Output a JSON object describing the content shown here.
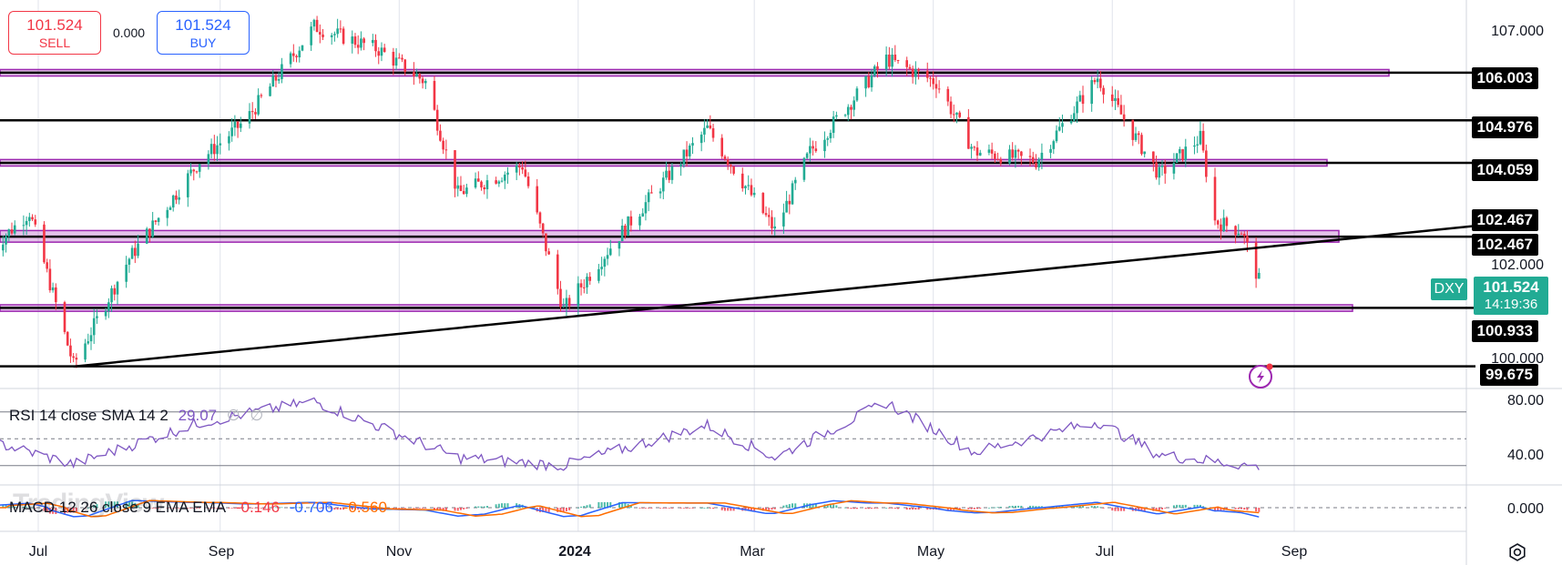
{
  "trade": {
    "sell_price": "101.524",
    "sell_label": "SELL",
    "spread": "0.000",
    "buy_price": "101.524",
    "buy_label": "BUY"
  },
  "symbol": "DXY",
  "current_price": "101.524",
  "countdown": "14:19:36",
  "watermark": "TradingView",
  "rsi": {
    "label": "RSI 14 close SMA 14 2",
    "value": "29.07",
    "extra1": "∅",
    "extra2": "∅"
  },
  "macd": {
    "label": "MACD 12 26 close 9 EMA EMA",
    "hist": "-0.146",
    "macd": "-0.706",
    "signal": "-0.560"
  },
  "price_axis": {
    "ticks": [
      "107.000",
      "102.000",
      "100.000"
    ],
    "level_tags": [
      "106.003",
      "104.976",
      "104.059",
      "102.467",
      "102.467",
      "100.933",
      "99.675"
    ]
  },
  "rsi_axis": {
    "ticks": [
      "80.00",
      "40.00"
    ]
  },
  "macd_axis": {
    "ticks": [
      "0.000"
    ]
  },
  "time_axis": {
    "labels": [
      {
        "text": "Jul",
        "bold": false
      },
      {
        "text": "Sep",
        "bold": false
      },
      {
        "text": "Nov",
        "bold": false
      },
      {
        "text": "2024",
        "bold": true
      },
      {
        "text": "Mar",
        "bold": false
      },
      {
        "text": "May",
        "bold": false
      },
      {
        "text": "Jul",
        "bold": false
      },
      {
        "text": "Sep",
        "bold": false
      }
    ]
  },
  "colors": {
    "up": "#22ab94",
    "down": "#f23645",
    "zone": "#9c27b0",
    "rsi": "#7e57c2",
    "macd": "#2962ff",
    "signal": "#ff6d00"
  },
  "chart_data": {
    "type": "candlestick",
    "symbol": "DXY",
    "ylim": [
      99.3,
      107.4
    ],
    "period": "Jun 2023 – Aug 2024",
    "horizontal_levels": [
      106.003,
      104.976,
      104.059,
      102.467,
      100.933,
      99.675
    ],
    "zones": [
      {
        "low": 105.93,
        "high": 106.07
      },
      {
        "low": 103.99,
        "high": 104.13
      },
      {
        "low": 102.35,
        "high": 102.6
      },
      {
        "low": 100.86,
        "high": 101.0
      }
    ],
    "trendline": {
      "from": "2023-07-13",
      "from_value": 99.67,
      "to_value": 102.7
    },
    "series_close_anchors": [
      {
        "x": "2023-06-15",
        "y": 102.2
      },
      {
        "x": "2023-06-28",
        "y": 103.0
      },
      {
        "x": "2023-07-13",
        "y": 99.7
      },
      {
        "x": "2023-08-01",
        "y": 102.0
      },
      {
        "x": "2023-08-25",
        "y": 104.1
      },
      {
        "x": "2023-09-10",
        "y": 105.0
      },
      {
        "x": "2023-10-03",
        "y": 107.0
      },
      {
        "x": "2023-10-25",
        "y": 106.5
      },
      {
        "x": "2023-11-10",
        "y": 105.8
      },
      {
        "x": "2023-11-21",
        "y": 103.4
      },
      {
        "x": "2023-12-13",
        "y": 104.0
      },
      {
        "x": "2023-12-27",
        "y": 100.9
      },
      {
        "x": "2024-01-15",
        "y": 102.5
      },
      {
        "x": "2024-02-14",
        "y": 104.8
      },
      {
        "x": "2024-03-08",
        "y": 102.6
      },
      {
        "x": "2024-03-20",
        "y": 104.3
      },
      {
        "x": "2024-04-15",
        "y": 106.3
      },
      {
        "x": "2024-05-02",
        "y": 105.8
      },
      {
        "x": "2024-05-15",
        "y": 104.3
      },
      {
        "x": "2024-06-05",
        "y": 104.1
      },
      {
        "x": "2024-06-26",
        "y": 105.9
      },
      {
        "x": "2024-07-17",
        "y": 103.8
      },
      {
        "x": "2024-07-31",
        "y": 104.6
      },
      {
        "x": "2024-08-05",
        "y": 102.8
      },
      {
        "x": "2024-08-14",
        "y": 102.6
      },
      {
        "x": "2024-08-20",
        "y": 101.52
      }
    ],
    "rsi_anchors": [
      {
        "x": "2023-06-15",
        "y": 48
      },
      {
        "x": "2023-07-13",
        "y": 31
      },
      {
        "x": "2023-08-25",
        "y": 62
      },
      {
        "x": "2023-10-03",
        "y": 78
      },
      {
        "x": "2023-11-21",
        "y": 36
      },
      {
        "x": "2023-12-27",
        "y": 30
      },
      {
        "x": "2024-02-14",
        "y": 60
      },
      {
        "x": "2024-03-08",
        "y": 36
      },
      {
        "x": "2024-04-15",
        "y": 77
      },
      {
        "x": "2024-05-15",
        "y": 40
      },
      {
        "x": "2024-06-26",
        "y": 63
      },
      {
        "x": "2024-07-17",
        "y": 38
      },
      {
        "x": "2024-08-20",
        "y": 29.07
      }
    ],
    "rsi_levels": [
      70,
      50,
      30
    ],
    "macd_last": {
      "histogram": -0.146,
      "macd": -0.706,
      "signal": -0.56
    }
  }
}
